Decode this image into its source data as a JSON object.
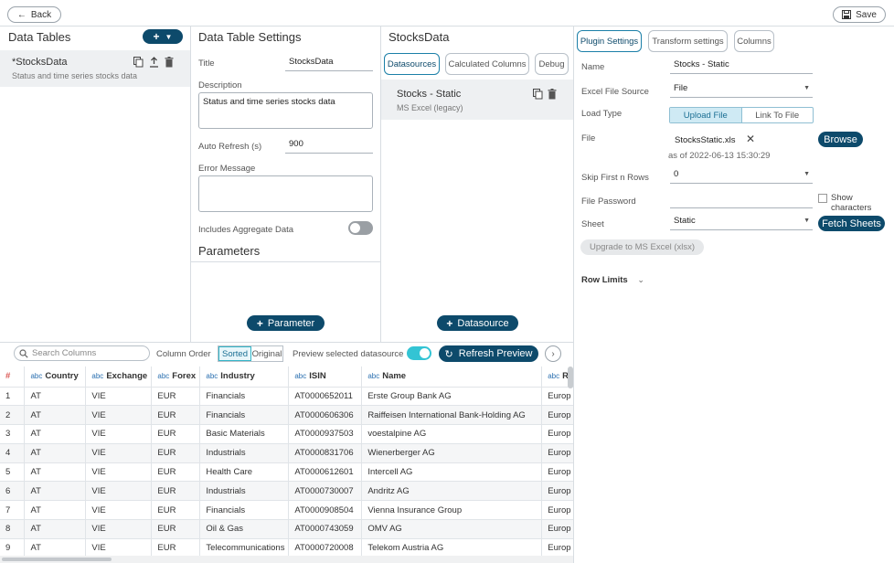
{
  "topbar": {
    "back_label": "Back",
    "save_label": "Save"
  },
  "data_tables": {
    "title": "Data Tables",
    "item_name": "*StocksData",
    "item_desc": "Status and time series stocks data"
  },
  "settings": {
    "title": "Data Table Settings",
    "title_label": "Title",
    "title_value": "StocksData",
    "description_label": "Description",
    "description_value": "Status and time series stocks data",
    "auto_refresh_label": "Auto Refresh (s)",
    "auto_refresh_value": "900",
    "error_label": "Error Message",
    "aggregate_label": "Includes Aggregate Data",
    "parameters_title": "Parameters",
    "parameter_button": "Parameter"
  },
  "stocks_data": {
    "title": "StocksData",
    "tabs": [
      "Datasources",
      "Calculated Columns",
      "Debug"
    ],
    "datasource_name": "Stocks - Static",
    "datasource_type": "MS Excel (legacy)",
    "datasource_button": "Datasource"
  },
  "plugin": {
    "tabs": [
      "Plugin Settings",
      "Transform settings",
      "Columns"
    ],
    "name_label": "Name",
    "name_value": "Stocks - Static",
    "excel_source_label": "Excel File Source",
    "excel_source_value": "File",
    "load_type_label": "Load Type",
    "load_upload": "Upload File",
    "load_link": "Link To File",
    "file_label": "File",
    "file_name": "StocksStatic.xls",
    "file_date": "as of 2022-06-13 15:30:29",
    "browse_label": "Browse",
    "skip_label": "Skip First n Rows",
    "skip_value": "0",
    "password_label": "File Password",
    "show_chars_label": "Show characters",
    "sheet_label": "Sheet",
    "sheet_value": "Static",
    "fetch_label": "Fetch Sheets",
    "upgrade_label": "Upgrade to MS Excel (xlsx)",
    "row_limits_label": "Row Limits"
  },
  "preview": {
    "search_placeholder": "Search Columns",
    "column_order_label": "Column Order",
    "sorted_label": "Sorted",
    "original_label": "Original",
    "preview_selected_label": "Preview selected datasource",
    "refresh_label": "Refresh Preview",
    "columns": [
      {
        "type": "#",
        "name": ""
      },
      {
        "type": "abc",
        "name": "Country"
      },
      {
        "type": "abc",
        "name": "Exchange"
      },
      {
        "type": "abc",
        "name": "Forex"
      },
      {
        "type": "abc",
        "name": "Industry"
      },
      {
        "type": "abc",
        "name": "ISIN"
      },
      {
        "type": "abc",
        "name": "Name"
      },
      {
        "type": "abc",
        "name": "R"
      }
    ],
    "rows": [
      [
        "1",
        "AT",
        "VIE",
        "EUR",
        "Financials",
        "AT0000652011",
        "Erste Group Bank AG",
        "Europ"
      ],
      [
        "2",
        "AT",
        "VIE",
        "EUR",
        "Financials",
        "AT0000606306",
        "Raiffeisen International Bank-Holding AG",
        "Europ"
      ],
      [
        "3",
        "AT",
        "VIE",
        "EUR",
        "Basic Materials",
        "AT0000937503",
        "voestalpine AG",
        "Europ"
      ],
      [
        "4",
        "AT",
        "VIE",
        "EUR",
        "Industrials",
        "AT0000831706",
        "Wienerberger AG",
        "Europ"
      ],
      [
        "5",
        "AT",
        "VIE",
        "EUR",
        "Health Care",
        "AT0000612601",
        "Intercell AG",
        "Europ"
      ],
      [
        "6",
        "AT",
        "VIE",
        "EUR",
        "Industrials",
        "AT0000730007",
        "Andritz AG",
        "Europ"
      ],
      [
        "7",
        "AT",
        "VIE",
        "EUR",
        "Financials",
        "AT0000908504",
        "Vienna Insurance Group",
        "Europ"
      ],
      [
        "8",
        "AT",
        "VIE",
        "EUR",
        "Oil & Gas",
        "AT0000743059",
        "OMV AG",
        "Europ"
      ],
      [
        "9",
        "AT",
        "VIE",
        "EUR",
        "Telecommunications",
        "AT0000720008",
        "Telekom Austria AG",
        "Europ"
      ]
    ]
  },
  "colors": {
    "accent_dark": "#0d4a6b",
    "accent_teal": "#33c4d4",
    "hash_red": "#d9534f"
  }
}
